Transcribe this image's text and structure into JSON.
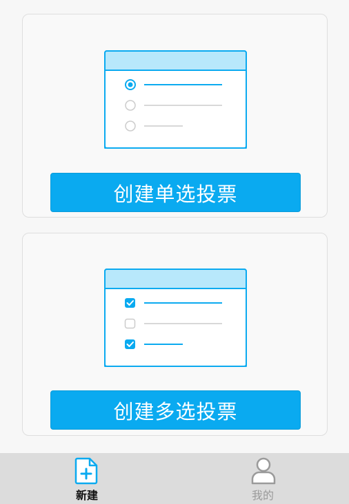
{
  "cards": [
    {
      "kind": "single",
      "button_label": "创建单选投票",
      "illustration": {
        "icon": "single-choice-list-icon",
        "options": [
          {
            "control": "radio",
            "selected": true
          },
          {
            "control": "radio",
            "selected": false
          },
          {
            "control": "radio",
            "selected": false
          }
        ]
      }
    },
    {
      "kind": "multiple",
      "button_label": "创建多选投票",
      "illustration": {
        "icon": "multiple-choice-list-icon",
        "options": [
          {
            "control": "checkbox",
            "selected": true
          },
          {
            "control": "checkbox",
            "selected": false
          },
          {
            "control": "checkbox",
            "selected": true
          }
        ]
      }
    }
  ],
  "tabbar": {
    "tabs": [
      {
        "label": "新建",
        "icon": "new-document-plus-icon",
        "active": true
      },
      {
        "label": "我的",
        "icon": "user-profile-icon",
        "active": false
      }
    ]
  },
  "colors": {
    "accent": "#0aaaf0",
    "accent_light": "#b8e8fb",
    "inactive": "#cccccc",
    "tab_inactive_text": "#9a9a9a",
    "tabbar_bg": "#dcdcdc"
  }
}
